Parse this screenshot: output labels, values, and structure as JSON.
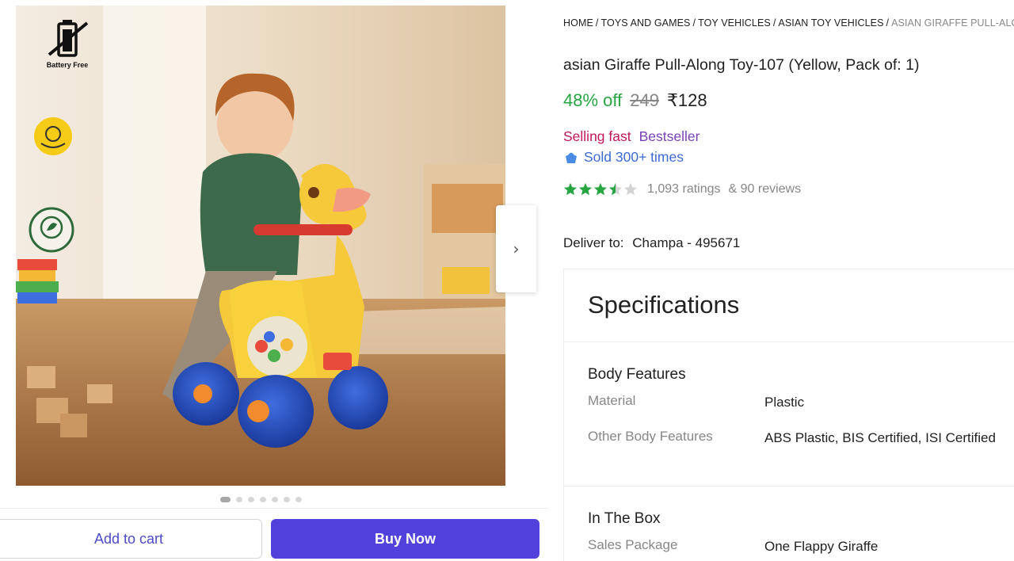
{
  "gallery": {
    "badges": {
      "battery_label": "Battery Free"
    },
    "next_arrow": "›",
    "dot_count": 7,
    "active_dot": 0
  },
  "actions": {
    "add_to_cart": "Add to cart",
    "buy_now": "Buy Now"
  },
  "breadcrumb": {
    "items": [
      "HOME",
      "TOYS AND GAMES",
      "TOY VEHICLES",
      "ASIAN TOY VEHICLES"
    ],
    "current": "ASIAN GIRAFFE PULL-ALO"
  },
  "product": {
    "title": "asian Giraffe Pull-Along Toy-107 (Yellow, Pack of: 1)",
    "discount": "48% off",
    "mrp": "249",
    "price": "₹128",
    "selling_fast": "Selling fast",
    "bestseller": "Bestseller",
    "sold": "Sold 300+ times",
    "rating_value": 3.5,
    "ratings_text": "1,093 ratings",
    "reviews_text": "& 90 reviews"
  },
  "delivery": {
    "label": "Deliver to:",
    "location": "Champa - 495671"
  },
  "specifications": {
    "heading": "Specifications",
    "sections": [
      {
        "title": "Body Features",
        "rows": [
          {
            "key": "Material",
            "value": "Plastic"
          },
          {
            "key": "Other Body Features",
            "value": "ABS Plastic, BIS Certified, ISI Certified"
          }
        ]
      },
      {
        "title": "In The Box",
        "rows": [
          {
            "key": "Sales Package",
            "value": "One Flappy Giraffe"
          }
        ]
      }
    ]
  },
  "colors": {
    "green": "#26a541",
    "brand": "#5242dd",
    "star": "#26a541"
  }
}
